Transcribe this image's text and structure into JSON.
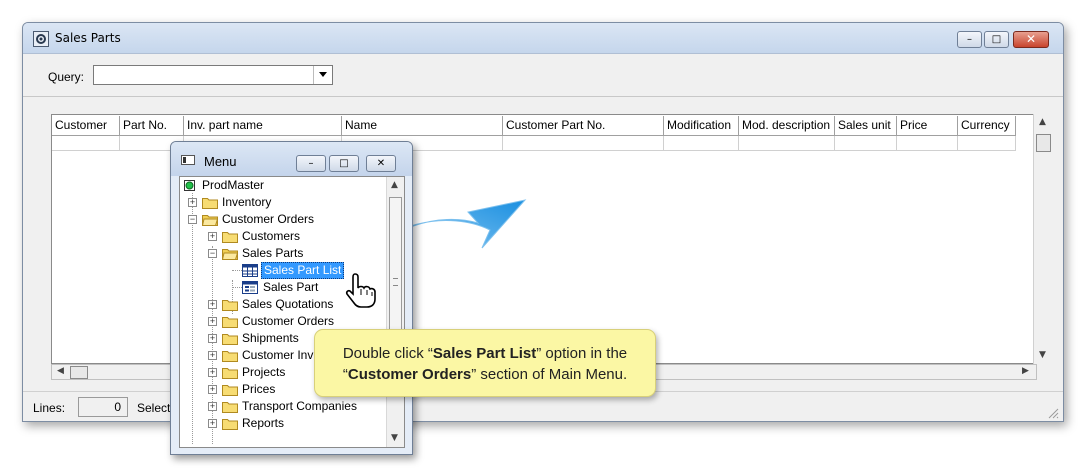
{
  "window": {
    "title": "Sales Parts",
    "controls": {
      "minimize": "–",
      "maximize": "□",
      "close": "✕"
    }
  },
  "query": {
    "label": "Query:",
    "value": ""
  },
  "table": {
    "columns": [
      "Customer",
      "Part No.",
      "Inv. part name",
      "Name",
      "Customer Part No.",
      "Modification",
      "Mod. description",
      "Sales unit",
      "Price",
      "Currency"
    ]
  },
  "status": {
    "lines_label": "Lines:",
    "lines_value": "0",
    "select_text": "Select"
  },
  "menu": {
    "title": "Menu",
    "tree": [
      {
        "label": "ProdMaster",
        "icon": "green-circle-icon",
        "expander": ""
      },
      {
        "label": "Inventory",
        "icon": "folder-icon",
        "expander": "+"
      },
      {
        "label": "Customer Orders",
        "icon": "open-folder-icon",
        "expander": "−"
      },
      {
        "label": "Customers",
        "icon": "folder-icon",
        "expander": "+"
      },
      {
        "label": "Sales Parts",
        "icon": "open-folder-icon",
        "expander": "−"
      },
      {
        "label": "Sales Part List",
        "icon": "grid-icon",
        "expander": "",
        "selected": true
      },
      {
        "label": "Sales Part",
        "icon": "form-icon",
        "expander": ""
      },
      {
        "label": "Sales Quotations",
        "icon": "folder-icon",
        "expander": "+"
      },
      {
        "label": "Customer Orders",
        "icon": "folder-icon",
        "expander": "+"
      },
      {
        "label": "Shipments",
        "icon": "folder-icon",
        "expander": "+"
      },
      {
        "label": "Customer Inv",
        "icon": "folder-icon",
        "expander": "+"
      },
      {
        "label": "Projects",
        "icon": "folder-icon",
        "expander": "+"
      },
      {
        "label": "Prices",
        "icon": "folder-icon",
        "expander": "+"
      },
      {
        "label": "Transport Companies",
        "icon": "folder-icon",
        "expander": "+"
      },
      {
        "label": "Reports",
        "icon": "folder-icon",
        "expander": "+"
      }
    ]
  },
  "callout": {
    "line1_pre": "Double click “",
    "line1_bold": "Sales Part List",
    "line1_post": "” option in the",
    "line2_pre": "“",
    "line2_bold": "Customer Orders",
    "line2_post": "” section of Main Menu."
  },
  "colors": {
    "selection": "#3399ff",
    "callout_bg": "#fbf7a4",
    "arrow": "#2fa0e6"
  }
}
